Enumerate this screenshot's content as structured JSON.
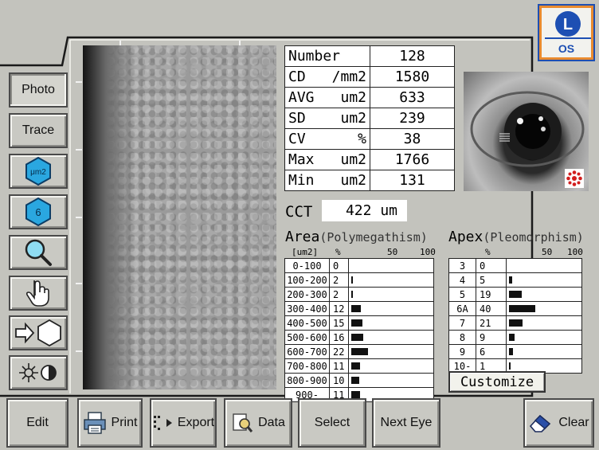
{
  "eye_side": "OS",
  "eye_badge_letter": "L",
  "tools": [
    {
      "label": "Photo",
      "active": true
    },
    {
      "label": "Trace"
    },
    {
      "label": "μm2",
      "icon": "hexagon-area-icon"
    },
    {
      "label": "6",
      "icon": "hexagon-number-icon"
    },
    {
      "icon": "magnifier-icon"
    },
    {
      "icon": "hand-pointer-icon"
    },
    {
      "icon": "arrow-hexagon-icon"
    },
    {
      "icon": "brightness-contrast-icon"
    }
  ],
  "stats": [
    {
      "label": "Number",
      "unit": "",
      "value": "128"
    },
    {
      "label": "CD",
      "unit": "/mm2",
      "value": "1580"
    },
    {
      "label": "AVG",
      "unit": "um2",
      "value": "633"
    },
    {
      "label": "SD",
      "unit": "um2",
      "value": "239"
    },
    {
      "label": "CV",
      "unit": "%",
      "value": "38"
    },
    {
      "label": "Max",
      "unit": "um2",
      "value": "1766"
    },
    {
      "label": "Min",
      "unit": "um2",
      "value": "131"
    }
  ],
  "cct": {
    "label": "CCT",
    "value": "422 um"
  },
  "area": {
    "title": "Area",
    "subtitle": "(Polymegathism)",
    "unit_header": "[um2]",
    "pct_header": "%",
    "scale_50": "50",
    "scale_100": "100",
    "rows": [
      {
        "range": "0-100",
        "pct": "0",
        "v": 0
      },
      {
        "range": "100-200",
        "pct": "2",
        "v": 2
      },
      {
        "range": "200-300",
        "pct": "2",
        "v": 2
      },
      {
        "range": "300-400",
        "pct": "12",
        "v": 12
      },
      {
        "range": "400-500",
        "pct": "15",
        "v": 15
      },
      {
        "range": "500-600",
        "pct": "16",
        "v": 16
      },
      {
        "range": "600-700",
        "pct": "22",
        "v": 22
      },
      {
        "range": "700-800",
        "pct": "11",
        "v": 11
      },
      {
        "range": "800-900",
        "pct": "10",
        "v": 10
      },
      {
        "range": "900-",
        "pct": "11",
        "v": 11
      }
    ]
  },
  "apex": {
    "title": "Apex",
    "subtitle": "(Pleomorphism)",
    "pct_header": "%",
    "scale_50": "50",
    "scale_100": "100",
    "rows": [
      {
        "n": "3",
        "pct": "0",
        "v": 0
      },
      {
        "n": "4",
        "pct": "5",
        "v": 5
      },
      {
        "n": "5",
        "pct": "19",
        "v": 19
      },
      {
        "n": "6A",
        "pct": "40",
        "v": 40
      },
      {
        "n": "7",
        "pct": "21",
        "v": 21
      },
      {
        "n": "8",
        "pct": "9",
        "v": 9
      },
      {
        "n": "9",
        "pct": "6",
        "v": 6
      },
      {
        "n": "10-",
        "pct": "1",
        "v": 1
      }
    ]
  },
  "customize_label": "Customize",
  "bottom": {
    "edit": "Edit",
    "print": "Print",
    "export": "Export",
    "data": "Data",
    "select": "Select",
    "next_eye": "Next Eye",
    "clear": "Clear"
  }
}
